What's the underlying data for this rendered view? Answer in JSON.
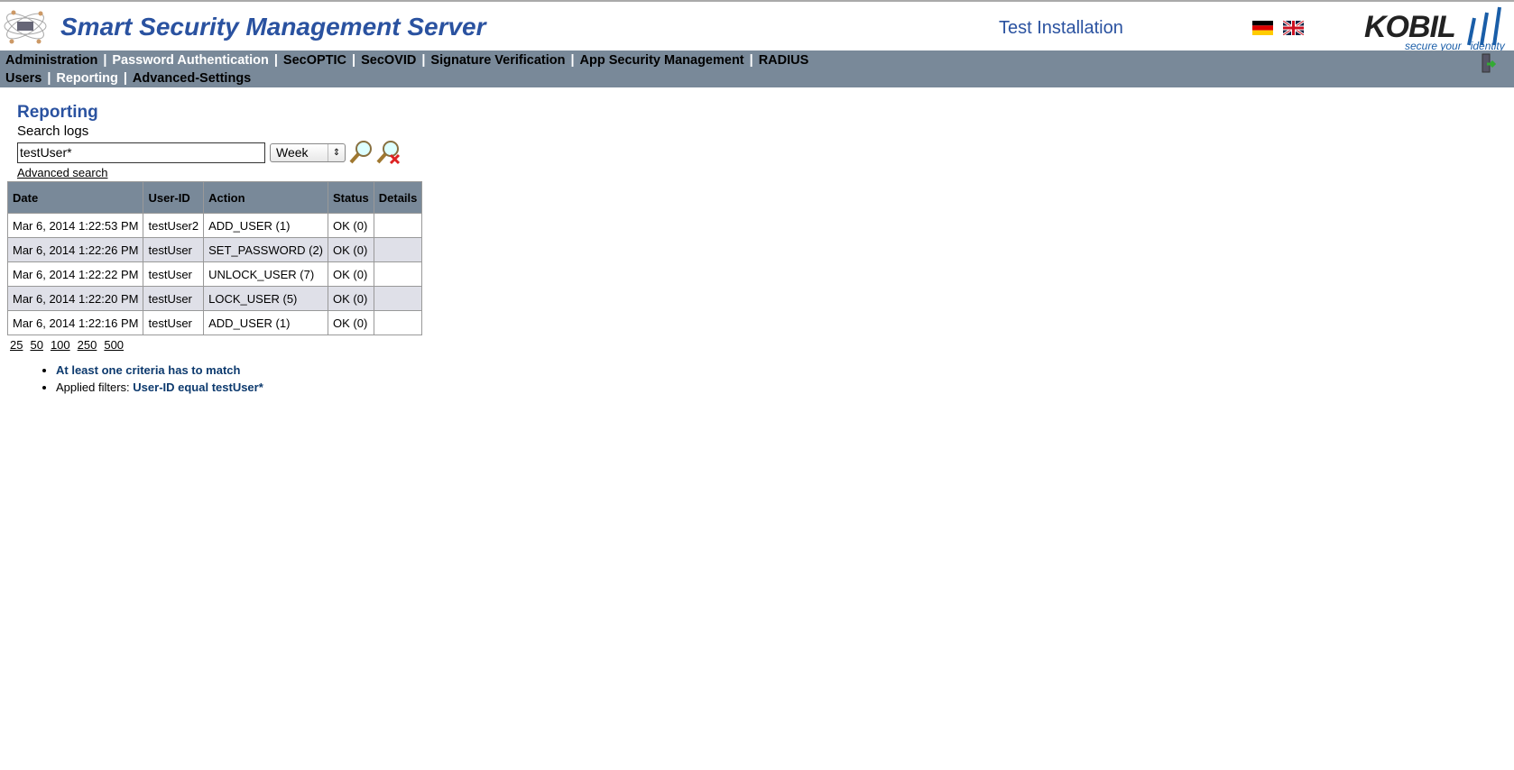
{
  "header": {
    "title": "Smart Security Management Server",
    "installation": "Test Installation",
    "brand": "KOBIL",
    "brand_tagline": "secure your identity"
  },
  "nav": {
    "row1": [
      {
        "label": "Administration",
        "active": false
      },
      {
        "label": "Password Authentication",
        "active": true
      },
      {
        "label": "SecOPTIC",
        "active": false
      },
      {
        "label": "SecOVID",
        "active": false
      },
      {
        "label": "Signature Verification",
        "active": false
      },
      {
        "label": "App Security Management",
        "active": false
      },
      {
        "label": "RADIUS",
        "active": false
      }
    ],
    "row2": [
      {
        "label": "Users",
        "active": false
      },
      {
        "label": "Reporting",
        "active": true
      },
      {
        "label": "Advanced-Settings",
        "active": false
      }
    ]
  },
  "main": {
    "heading": "Reporting",
    "search_label": "Search logs",
    "search_value": "testUser*",
    "period": "Week",
    "advanced": "Advanced search"
  },
  "table": {
    "columns": [
      "Date",
      "User-ID",
      "Action",
      "Status",
      "Details"
    ],
    "rows": [
      [
        "Mar 6, 2014 1:22:53 PM",
        "testUser2",
        "ADD_USER (1)",
        "OK (0)",
        ""
      ],
      [
        "Mar 6, 2014 1:22:26 PM",
        "testUser",
        "SET_PASSWORD (2)",
        "OK (0)",
        ""
      ],
      [
        "Mar 6, 2014 1:22:22 PM",
        "testUser",
        "UNLOCK_USER (7)",
        "OK (0)",
        ""
      ],
      [
        "Mar 6, 2014 1:22:20 PM",
        "testUser",
        "LOCK_USER (5)",
        "OK (0)",
        ""
      ],
      [
        "Mar 6, 2014 1:22:16 PM",
        "testUser",
        "ADD_USER (1)",
        "OK (0)",
        ""
      ]
    ]
  },
  "pager": [
    "25",
    "50",
    "100",
    "250",
    "500"
  ],
  "filters": {
    "criteria": "At least one criteria has to match",
    "applied_label": "Applied filters:",
    "applied_value": "User-ID equal testUser*"
  },
  "colors": {
    "nav": "#798999",
    "title": "#2a52a0",
    "alt_row": "#dfe0e8"
  }
}
